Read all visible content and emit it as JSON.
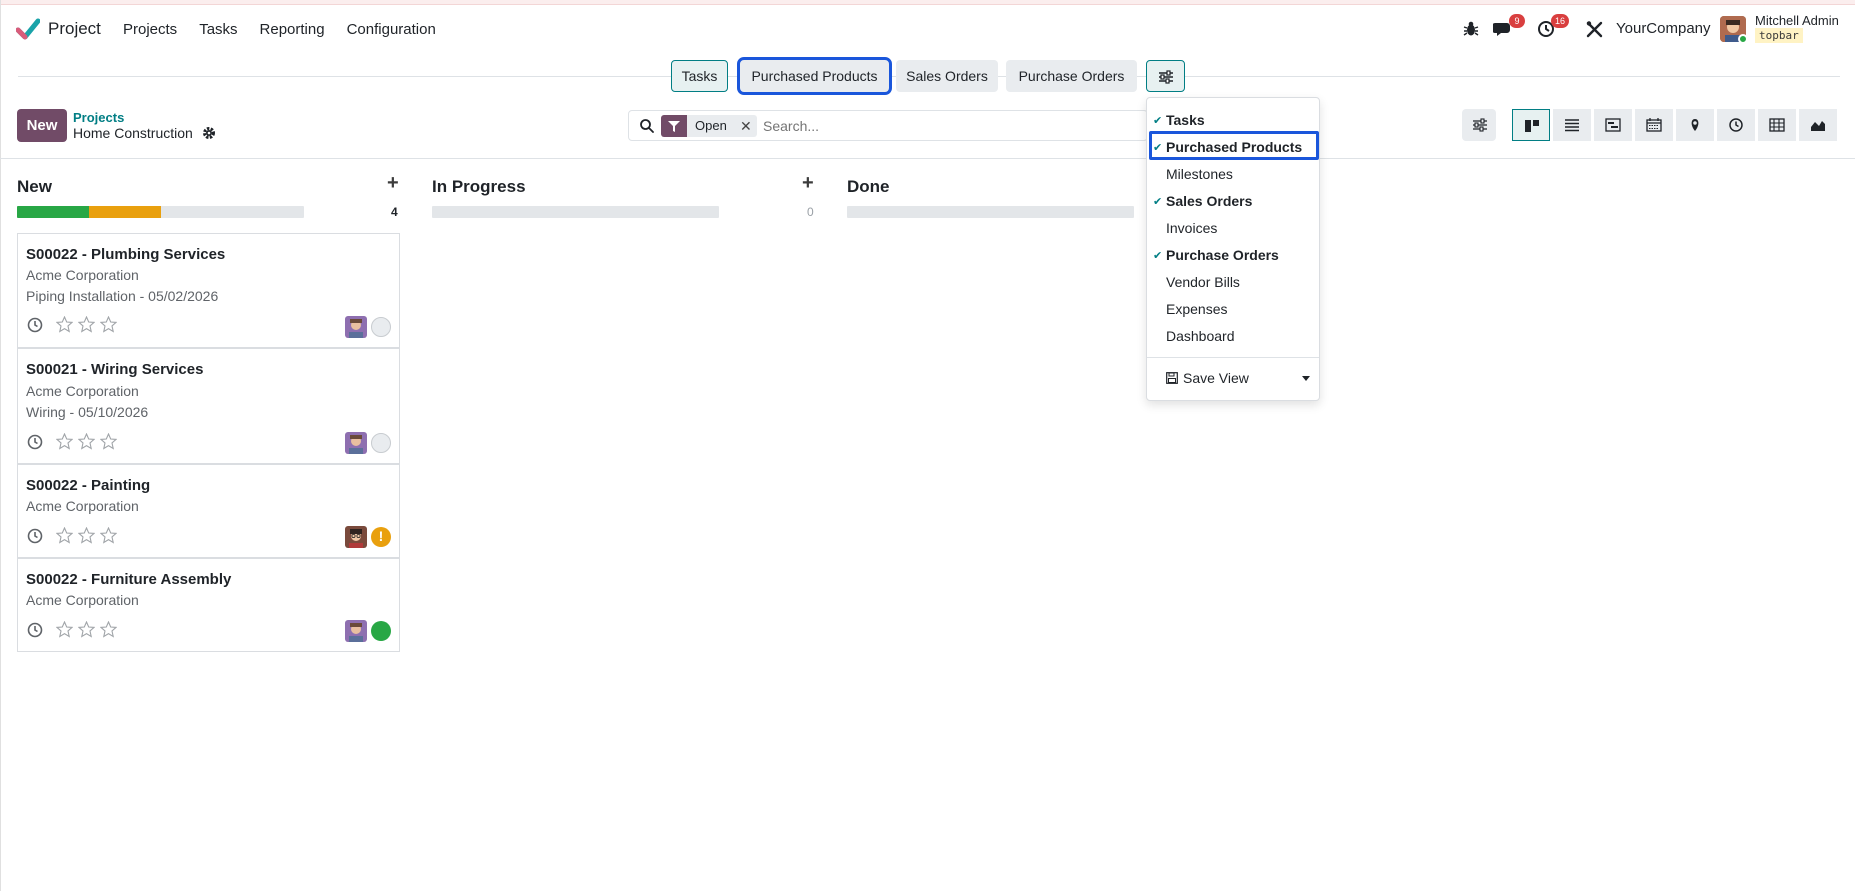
{
  "app": {
    "name": "Project"
  },
  "menu": [
    "Projects",
    "Tasks",
    "Reporting",
    "Configuration"
  ],
  "systray": {
    "messages_count": "9",
    "activities_count": "16"
  },
  "company": "YourCompany",
  "user": {
    "name": "Mitchell Admin",
    "db": "topbar"
  },
  "actions": {
    "tasks": "Tasks",
    "purchased_products": "Purchased Products",
    "sales_orders": "Sales Orders",
    "purchase_orders": "Purchase Orders"
  },
  "control": {
    "new_label": "New",
    "breadcrumb_parent": "Projects",
    "breadcrumb_current": "Home Construction",
    "facet_value": "Open",
    "search_placeholder": "Search..."
  },
  "columns": [
    {
      "title": "New",
      "count": "4",
      "progress": {
        "green": 0.25,
        "orange": 0.25,
        "grey": 0.5
      }
    },
    {
      "title": "In Progress",
      "count": "0"
    },
    {
      "title": "Done"
    }
  ],
  "cards": [
    {
      "title": "S00022 - Plumbing Services",
      "customer": "Acme Corporation",
      "detail": "Piping Installation - 05/02/2026",
      "stars": 0,
      "state": "normal"
    },
    {
      "title": "S00021 - Wiring Services",
      "customer": "Acme Corporation",
      "detail": "Wiring - 05/10/2026",
      "stars": 0,
      "state": "normal"
    },
    {
      "title": "S00022 - Painting",
      "customer": "Acme Corporation",
      "stars": 0,
      "state": "changes_requested"
    },
    {
      "title": "S00022 - Furniture Assembly",
      "customer": "Acme Corporation",
      "stars": 0,
      "state": "approved"
    }
  ],
  "dropdown": {
    "items": [
      {
        "label": "Tasks",
        "checked": true
      },
      {
        "label": "Purchased Products",
        "checked": true
      },
      {
        "label": "Milestones",
        "checked": false
      },
      {
        "label": "Sales Orders",
        "checked": true
      },
      {
        "label": "Invoices",
        "checked": false
      },
      {
        "label": "Purchase Orders",
        "checked": true
      },
      {
        "label": "Vendor Bills",
        "checked": false
      },
      {
        "label": "Expenses",
        "checked": false
      },
      {
        "label": "Dashboard",
        "checked": false
      }
    ],
    "save_view": "Save View"
  },
  "colors": {
    "brand": "#714b67",
    "teal": "#017e84",
    "progress_green": "#28a745",
    "progress_orange": "#e9a00e",
    "highlight": "#1a56db"
  },
  "icons": [
    "bug-icon",
    "chat-icon",
    "clock-icon",
    "tools-icon",
    "gear-icon",
    "search-icon",
    "filter-icon",
    "star-icon",
    "floppy-icon"
  ]
}
